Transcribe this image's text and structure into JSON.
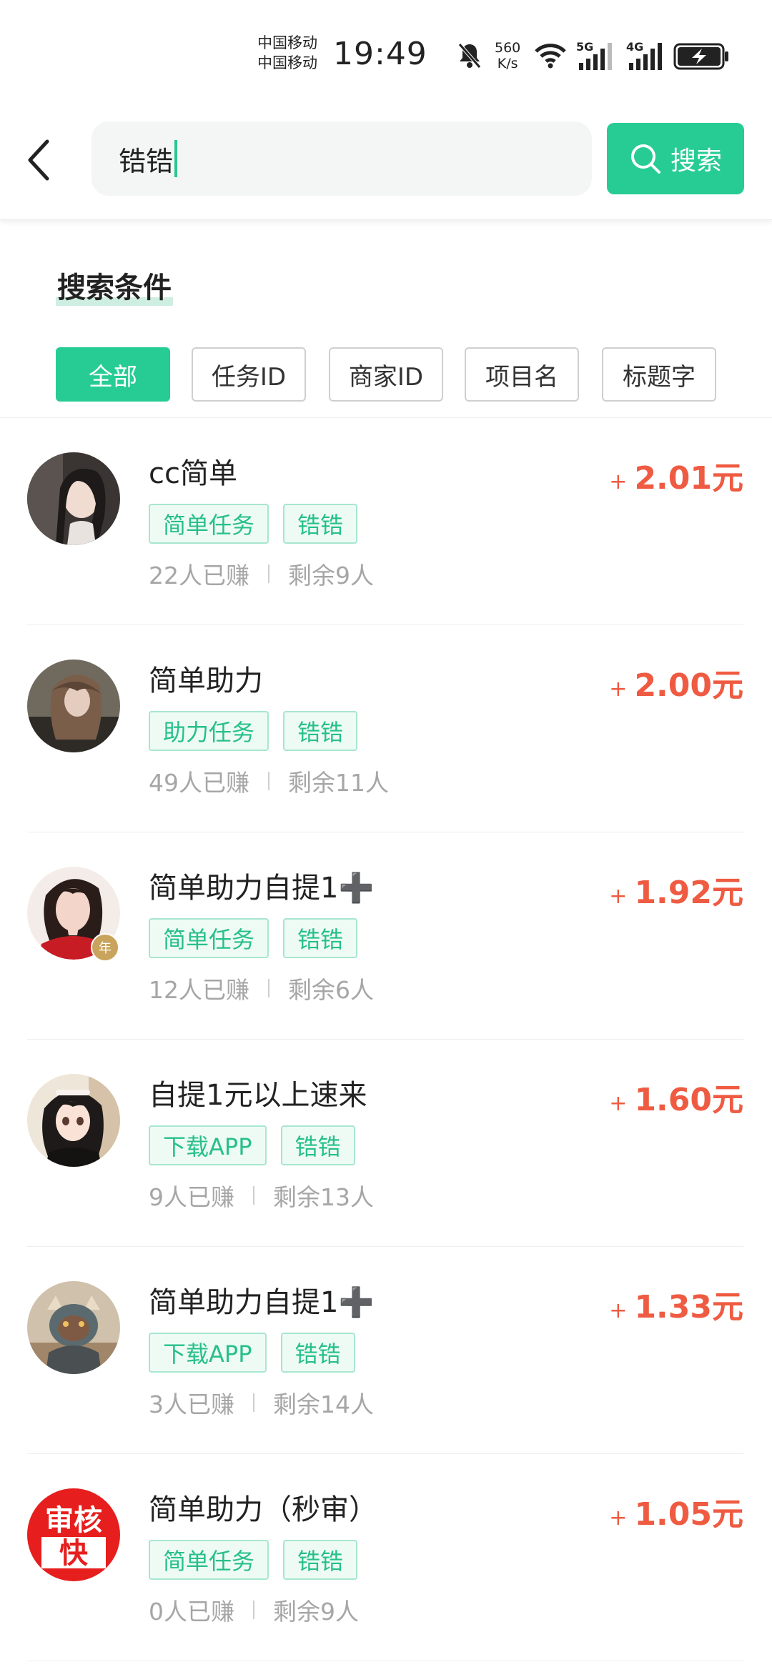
{
  "status_bar": {
    "carrier_1": "中国移动",
    "carrier_2": "中国移动",
    "time": "19:49",
    "net_speed_value": "560",
    "net_speed_unit": "K/s",
    "signal_1": "5G",
    "signal_2": "4G",
    "icons": [
      "bell-muted-icon",
      "wifi-icon",
      "signal-5g-icon",
      "signal-4g-icon",
      "battery-charging-icon"
    ]
  },
  "search": {
    "value": "锆锆",
    "button_label": "搜索",
    "icons": [
      "back-arrow-icon",
      "search-icon"
    ]
  },
  "conditions": {
    "title": "搜索条件",
    "filters": [
      "全部",
      "任务ID",
      "商家ID",
      "项目名",
      "标题字"
    ],
    "active_filter": "全部"
  },
  "accent_colors": {
    "brand_green": "#27cc94",
    "price_red": "#ef5b42",
    "tag_green": "#27c088"
  },
  "tasks": [
    {
      "title": "cc简单",
      "tags": [
        "简单任务",
        "锆锆"
      ],
      "earned": "22人已赚",
      "remaining": "剩余9人",
      "price_prefix": "+",
      "price": "2.01",
      "unit": "元"
    },
    {
      "title": "简单助力",
      "tags": [
        "助力任务",
        "锆锆"
      ],
      "earned": "49人已赚",
      "remaining": "剩余11人",
      "price_prefix": "+",
      "price": "2.00",
      "unit": "元"
    },
    {
      "title": "简单助力自提1➕",
      "tags": [
        "简单任务",
        "锆锆"
      ],
      "earned": "12人已赚",
      "remaining": "剩余6人",
      "price_prefix": "+",
      "price": "1.92",
      "unit": "元",
      "avatar_badge": "年"
    },
    {
      "title": "自提1元以上速来",
      "tags": [
        "下载APP",
        "锆锆"
      ],
      "earned": "9人已赚",
      "remaining": "剩余13人",
      "price_prefix": "+",
      "price": "1.60",
      "unit": "元"
    },
    {
      "title": "简单助力自提1➕",
      "tags": [
        "下载APP",
        "锆锆"
      ],
      "earned": "3人已赚",
      "remaining": "剩余14人",
      "price_prefix": "+",
      "price": "1.33",
      "unit": "元"
    },
    {
      "title": "简单助力（秒审）",
      "tags": [
        "简单任务",
        "锆锆"
      ],
      "earned": "0人已赚",
      "remaining": "剩余9人",
      "price_prefix": "+",
      "price": "1.05",
      "unit": "元",
      "avatar_text_top": "审核",
      "avatar_text_bottom": "快"
    }
  ]
}
